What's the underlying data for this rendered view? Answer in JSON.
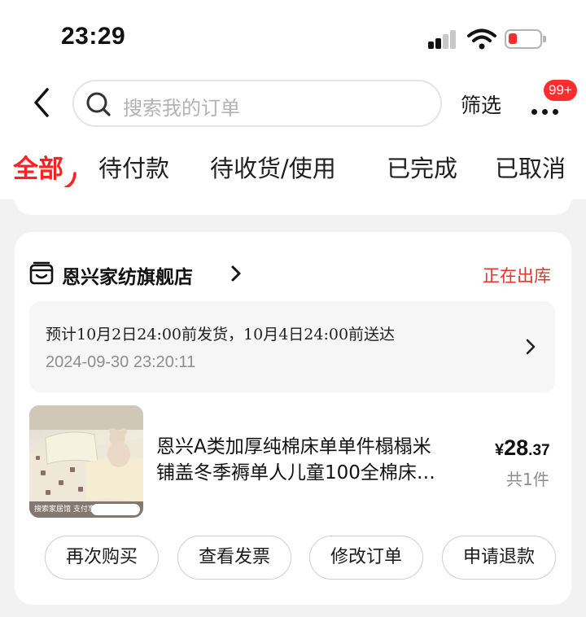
{
  "status_bar": {
    "time": "23:29"
  },
  "search": {
    "placeholder": "搜索我的订单"
  },
  "toolbar": {
    "filter_label": "筛选",
    "more_badge": "99+"
  },
  "tabs": [
    {
      "label": "全部",
      "active": true
    },
    {
      "label": "待付款"
    },
    {
      "label": "待收货/使用"
    },
    {
      "label": "已完成"
    },
    {
      "label": "已取消"
    }
  ],
  "order": {
    "shop_name": "恩兴家纺旗舰店",
    "status": "正在出库",
    "shipping": {
      "estimate": "预计10月2日24:00前发货，10月4日24:00前送达",
      "timestamp": "2024-09-30 23:20:11"
    },
    "product": {
      "title_line1": "恩兴A类加厚纯棉床单单件榻榻米",
      "title_line2": "铺盖冬季褥单人儿童100全棉床…",
      "price_symbol": "¥",
      "price_int": "28",
      "price_dec": ".37",
      "quantity": "共1件",
      "image_caption": "搜索家居馆 支付享5折"
    },
    "actions": [
      "再次购买",
      "查看发票",
      "修改订单",
      "申请退款"
    ]
  },
  "colors": {
    "accent": "#ff2020",
    "status": "#e8322a",
    "badge": "#ff2d2d"
  }
}
